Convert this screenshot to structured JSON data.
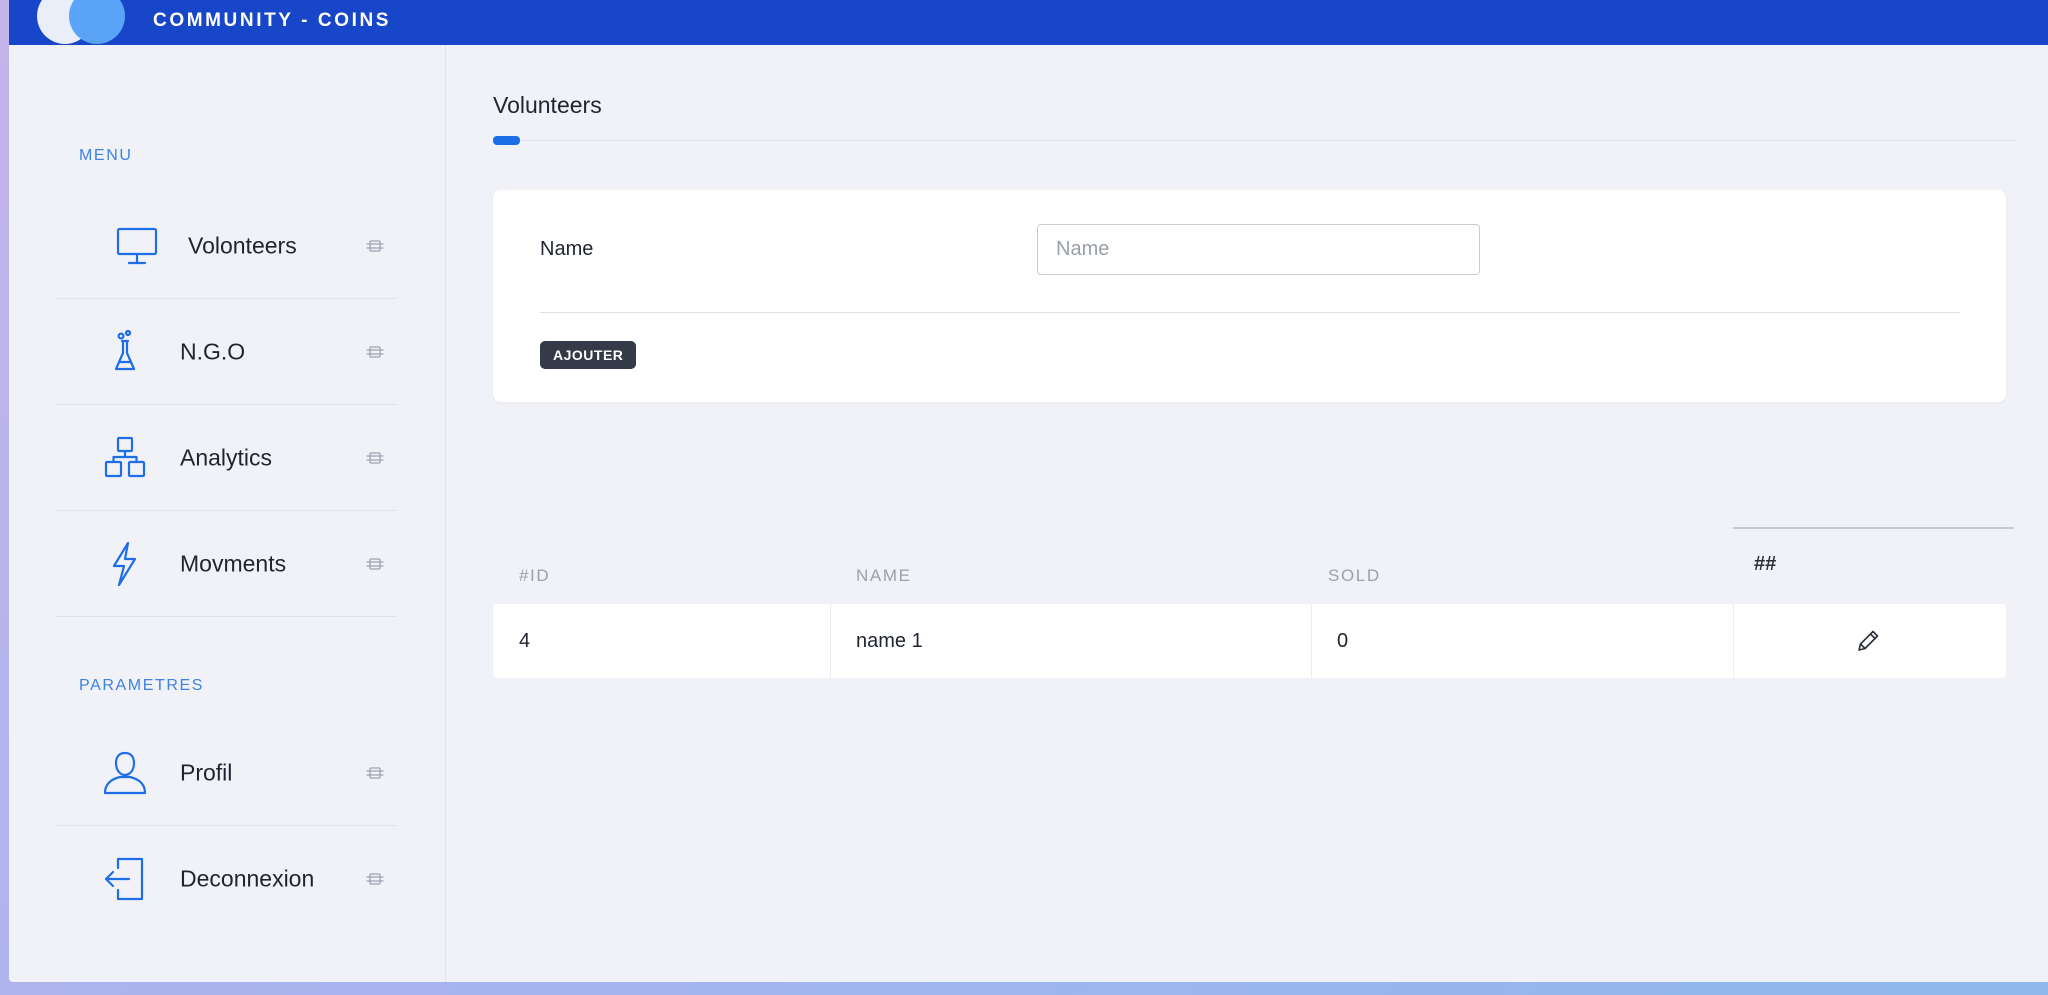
{
  "app": {
    "title": "COMMUNITY - COINS"
  },
  "sidebar": {
    "menu_label": "MENU",
    "params_label": "PARAMETRES",
    "menu_items": [
      {
        "label": "Volonteers",
        "icon": "monitor-icon"
      },
      {
        "label": "N.G.O",
        "icon": "flask-icon"
      },
      {
        "label": "Analytics",
        "icon": "hierarchy-icon"
      },
      {
        "label": "Movments",
        "icon": "lightning-icon"
      }
    ],
    "param_items": [
      {
        "label": "Profil",
        "icon": "user-icon"
      },
      {
        "label": "Deconnexion",
        "icon": "logout-icon"
      }
    ]
  },
  "main": {
    "title": "Volunteers",
    "form": {
      "name_label": "Name",
      "name_placeholder": "Name",
      "name_value": "",
      "add_button": "AJOUTER"
    },
    "table": {
      "headers": {
        "id": "#ID",
        "name": "NAME",
        "sold": "SOLD",
        "actions": "##"
      },
      "rows": [
        {
          "id": "4",
          "name": "name 1",
          "sold": "0"
        }
      ]
    }
  },
  "colors": {
    "topbar": "#1746c9",
    "accent": "#1c6de6",
    "icon_blue": "#1e6ee8",
    "button_dark": "#343a47",
    "page_bg": "#f1f2f7"
  }
}
